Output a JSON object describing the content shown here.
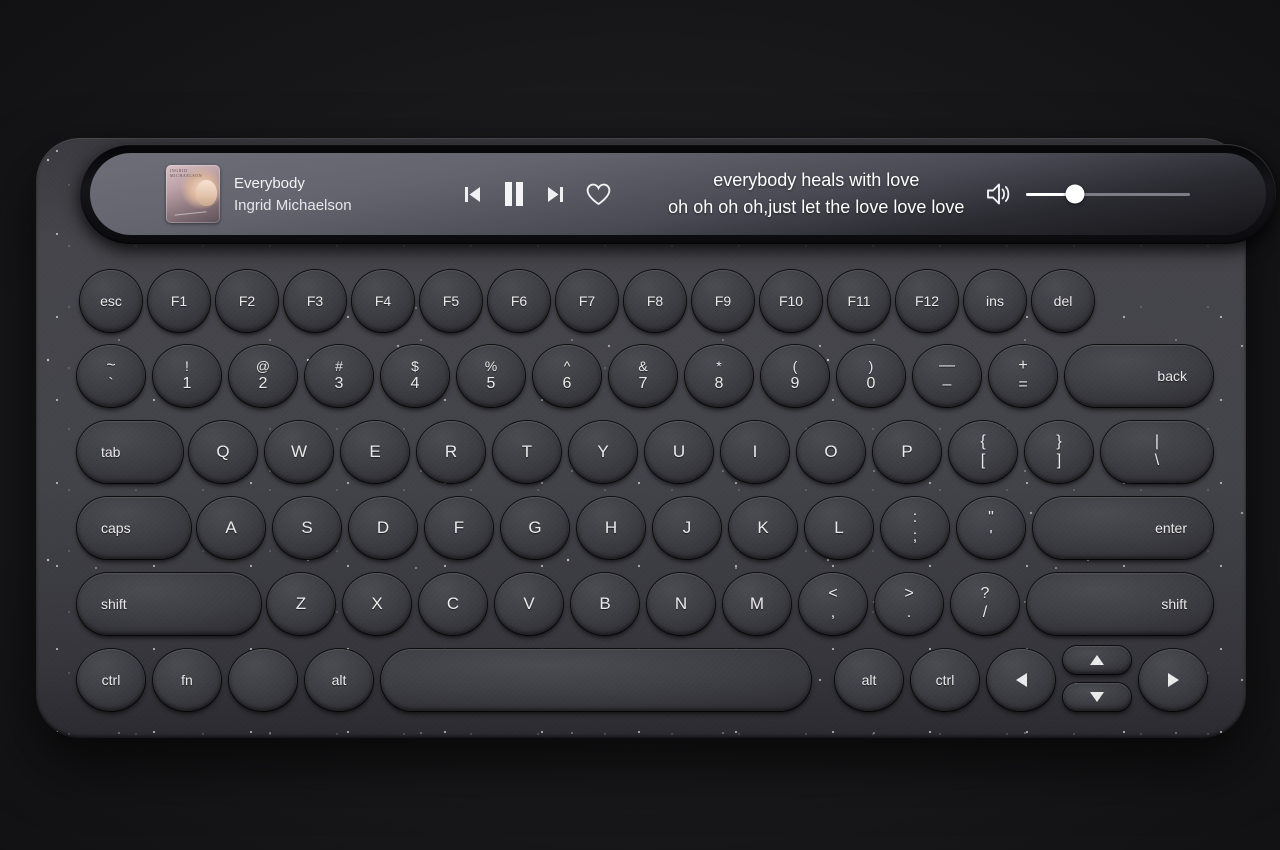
{
  "device": {
    "name": "bluetooth-multi-device-keyboard",
    "body_color": "#43434a"
  },
  "screen": {
    "now_playing": {
      "album_art_alt": "album-cover-everybody",
      "album_art_caption": "INGRID MICHAELSON",
      "track_title": "Everybody",
      "artist": "Ingrid Michaelson"
    },
    "transport": {
      "previous_label": "previous-track",
      "play_state_label": "pause",
      "next_label": "next-track",
      "favorite_label": "favorite"
    },
    "lyrics": {
      "line1": "everybody heals with love",
      "line2": "oh oh oh oh,just let the love love love"
    },
    "volume": {
      "icon_label": "volume-on",
      "level_percent": 30
    }
  },
  "keyboard": {
    "row_function": [
      {
        "label": "esc"
      },
      {
        "label": "F1"
      },
      {
        "label": "F2"
      },
      {
        "label": "F3"
      },
      {
        "label": "F4"
      },
      {
        "label": "F5"
      },
      {
        "label": "F6"
      },
      {
        "label": "F7"
      },
      {
        "label": "F8"
      },
      {
        "label": "F9"
      },
      {
        "label": "F10"
      },
      {
        "label": "F11"
      },
      {
        "label": "F12"
      },
      {
        "label": "ins"
      },
      {
        "label": "del"
      }
    ],
    "row_number": [
      {
        "top": "~",
        "bottom": "`"
      },
      {
        "top": "!",
        "bottom": "1"
      },
      {
        "top": "@",
        "bottom": "2"
      },
      {
        "top": "#",
        "bottom": "3"
      },
      {
        "top": "$",
        "bottom": "4"
      },
      {
        "top": "%",
        "bottom": "5"
      },
      {
        "top": "^",
        "bottom": "6"
      },
      {
        "top": "&",
        "bottom": "7"
      },
      {
        "top": "*",
        "bottom": "8"
      },
      {
        "top": "(",
        "bottom": "9"
      },
      {
        "top": ")",
        "bottom": "0"
      },
      {
        "top": "—",
        "bottom": "–"
      },
      {
        "top": "+",
        "bottom": "="
      }
    ],
    "backspace_label": "back",
    "row_top": [
      {
        "label": "Q"
      },
      {
        "label": "W"
      },
      {
        "label": "E"
      },
      {
        "label": "R"
      },
      {
        "label": "T"
      },
      {
        "label": "Y"
      },
      {
        "label": "U"
      },
      {
        "label": "I"
      },
      {
        "label": "O"
      },
      {
        "label": "P"
      }
    ],
    "tab_label": "tab",
    "bracket_left": {
      "top": "{",
      "bottom": "["
    },
    "bracket_right": {
      "top": "}",
      "bottom": "]"
    },
    "backslash": {
      "top": "|",
      "bottom": "\\"
    },
    "row_home": [
      {
        "label": "A"
      },
      {
        "label": "S"
      },
      {
        "label": "D"
      },
      {
        "label": "F"
      },
      {
        "label": "G"
      },
      {
        "label": "H"
      },
      {
        "label": "J"
      },
      {
        "label": "K"
      },
      {
        "label": "L"
      }
    ],
    "caps_label": "caps",
    "semicolon": {
      "top": ":",
      "bottom": ";"
    },
    "quote": {
      "top": "\"",
      "bottom": "'"
    },
    "enter_label": "enter",
    "row_bottom_letters": [
      {
        "label": "Z"
      },
      {
        "label": "X"
      },
      {
        "label": "C"
      },
      {
        "label": "V"
      },
      {
        "label": "B"
      },
      {
        "label": "N"
      },
      {
        "label": "M"
      }
    ],
    "shift_left_label": "shift",
    "shift_right_label": "shift",
    "comma": {
      "top": "<",
      "bottom": ","
    },
    "period": {
      "top": ">",
      "bottom": "."
    },
    "slash": {
      "top": "?",
      "bottom": "/"
    },
    "row_modifiers": {
      "ctrl_left": "ctrl",
      "fn": "fn",
      "super": "",
      "alt_left": "alt",
      "space": "",
      "alt_right": "alt",
      "ctrl_right": "ctrl"
    },
    "arrows": {
      "left": "arrow-left",
      "up": "arrow-up",
      "down": "arrow-down",
      "right": "arrow-right"
    }
  }
}
